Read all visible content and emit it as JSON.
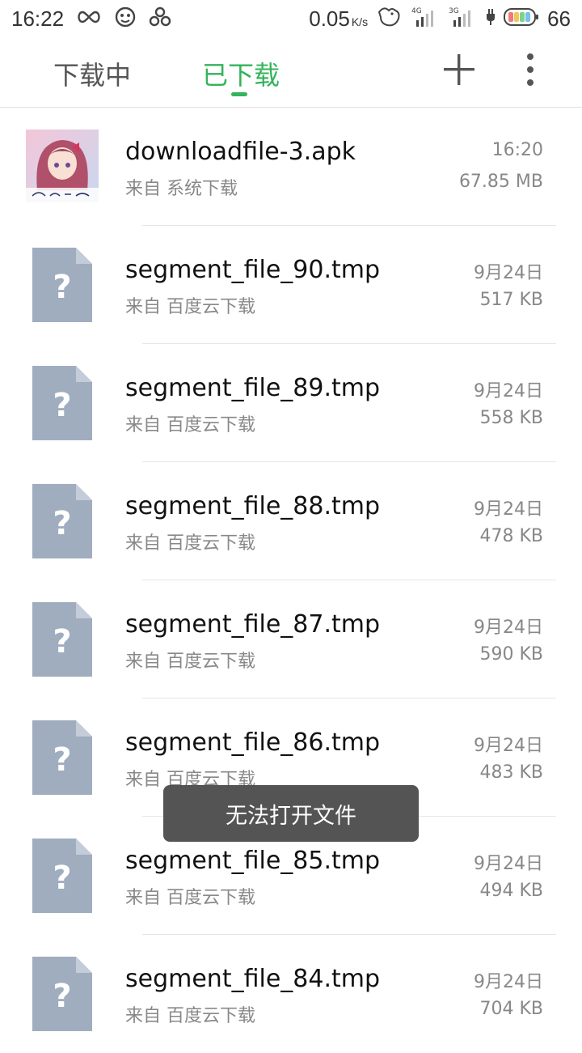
{
  "status_bar": {
    "time": "16:22",
    "speed_value": "0.05",
    "speed_unit": "K/s",
    "network_1": "4G",
    "network_2": "3G",
    "battery_percent": "66",
    "icons": [
      "infinity-icon",
      "gamepad-icon",
      "cloverleaf-icon",
      "bird-icon",
      "signal-4g-icon",
      "signal-3g-icon",
      "charging-icon",
      "battery-icon"
    ]
  },
  "tabs": {
    "downloading_label": "下载中",
    "downloaded_label": "已下载",
    "active": "已下载",
    "accent_color": "#33b35a"
  },
  "toolbar": {
    "add_icon": "plus-icon",
    "more_icon": "more-vertical-icon"
  },
  "files": [
    {
      "name": "downloadfile-3.apk",
      "source": "来自 系统下载",
      "date": "16:20",
      "size": "67.85 MB",
      "icon": "app-thumbnail"
    },
    {
      "name": "segment_file_90.tmp",
      "source": "来自 百度云下载",
      "date": "9月24日",
      "size": "517 KB",
      "icon": "unknown-file-icon"
    },
    {
      "name": "segment_file_89.tmp",
      "source": "来自 百度云下载",
      "date": "9月24日",
      "size": "558 KB",
      "icon": "unknown-file-icon"
    },
    {
      "name": "segment_file_88.tmp",
      "source": "来自 百度云下载",
      "date": "9月24日",
      "size": "478 KB",
      "icon": "unknown-file-icon"
    },
    {
      "name": "segment_file_87.tmp",
      "source": "来自 百度云下载",
      "date": "9月24日",
      "size": "590 KB",
      "icon": "unknown-file-icon"
    },
    {
      "name": "segment_file_86.tmp",
      "source": "来自 百度云下载",
      "date": "9月24日",
      "size": "483 KB",
      "icon": "unknown-file-icon"
    },
    {
      "name": "segment_file_85.tmp",
      "source": "来自 百度云下载",
      "date": "9月24日",
      "size": "494 KB",
      "icon": "unknown-file-icon"
    },
    {
      "name": "segment_file_84.tmp",
      "source": "来自 百度云下载",
      "date": "9月24日",
      "size": "704 KB",
      "icon": "unknown-file-icon"
    }
  ],
  "toast": {
    "message": "无法打开文件"
  }
}
